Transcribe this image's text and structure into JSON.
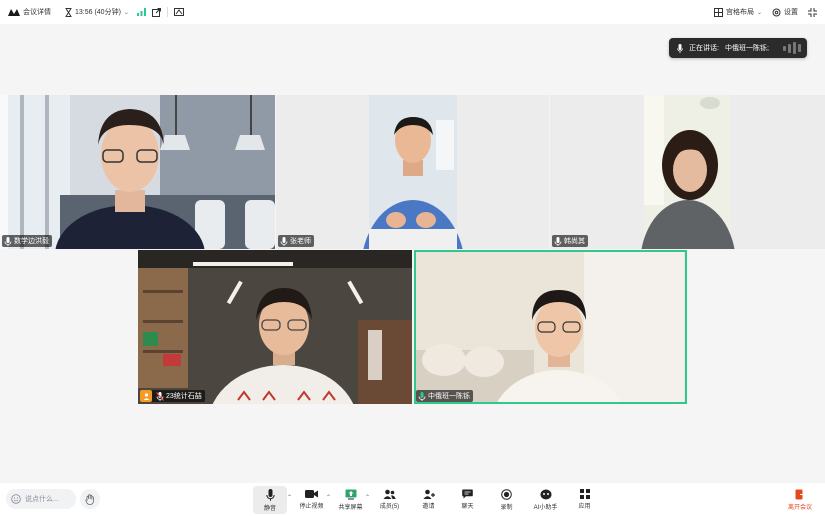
{
  "topbar": {
    "meeting_details": "会议详情",
    "time": "13:56 (40分钟)",
    "layout_label": "宫格布局",
    "settings_label": "设置"
  },
  "speaking": {
    "prefix": "正在讲话:",
    "name": "中俄班一陈铄;"
  },
  "participants": [
    {
      "name": "数学边洪毅"
    },
    {
      "name": "张老师"
    },
    {
      "name": "韩尚其"
    },
    {
      "name": "23统计石喆"
    },
    {
      "name": "中俄班一陈铄"
    }
  ],
  "bottombar": {
    "comment_placeholder": "说点什么...",
    "tools": [
      {
        "label": "静音",
        "icon": "mic-icon"
      },
      {
        "label": "停止视频",
        "icon": "video-icon"
      },
      {
        "label": "共享屏幕",
        "icon": "share-screen-icon"
      },
      {
        "label": "成员(5)",
        "icon": "members-icon"
      },
      {
        "label": "邀请",
        "icon": "invite-icon"
      },
      {
        "label": "聊天",
        "icon": "chat-icon"
      },
      {
        "label": "录制",
        "icon": "record-icon"
      },
      {
        "label": "AI小助手",
        "icon": "ai-assistant-icon"
      },
      {
        "label": "应用",
        "icon": "apps-icon"
      }
    ],
    "leave_label": "离开会议"
  },
  "colors": {
    "active_border": "#2fc98f",
    "host_badge": "#f59a23",
    "leave": "#e5481e",
    "signal": "#2fc98f"
  }
}
